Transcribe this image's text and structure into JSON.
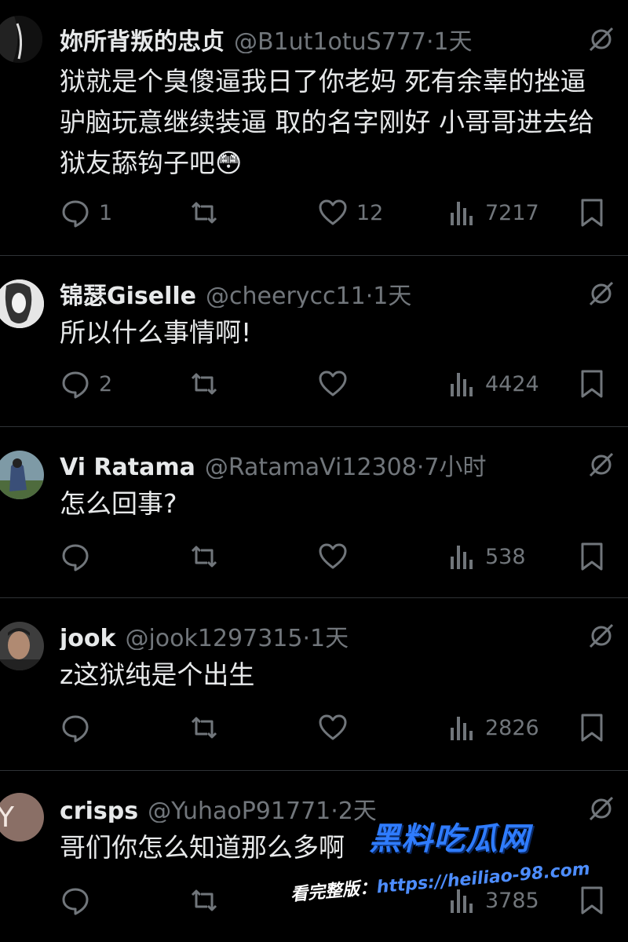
{
  "colors": {
    "background": "#000000",
    "text": "#e7e9ea",
    "secondary": "#71767b",
    "divider": "#2f3336",
    "watermark": "#2f7cff"
  },
  "posts": [
    {
      "name": "妳所背叛的忠贞",
      "handle": "@B1ut1otuS777",
      "time": "1天",
      "lines": [
        "狱就是个臭傻逼我日了你老妈 死有余辜的挫逼",
        "驴脑玩意继续装逼 取的名字刚好 小哥哥进去给",
        "狱友舔钩子吧😳"
      ],
      "replies": "1",
      "retweets": "",
      "likes": "12",
      "views": "7217",
      "avatar_color": "#1a1a1a"
    },
    {
      "name": "锦瑟Giselle",
      "handle": "@cheerycc11",
      "time": "1天",
      "lines": [
        "所以什么事情啊!"
      ],
      "replies": "2",
      "retweets": "",
      "likes": "",
      "views": "4424",
      "avatar_color": "#d8d8d8"
    },
    {
      "name": "Vi Ratama",
      "handle": "@RatamaVi12308",
      "time": "7小时",
      "lines": [
        "怎么回事?"
      ],
      "replies": "",
      "retweets": "",
      "likes": "",
      "views": "538",
      "avatar_color": "#5b7fa8"
    },
    {
      "name": "jook",
      "handle": "@jook1297315",
      "time": "1天",
      "lines": [
        "z这狱纯是个出生"
      ],
      "replies": "",
      "retweets": "",
      "likes": "",
      "views": "2826",
      "avatar_color": "#4a4a4a"
    },
    {
      "name": "crisps",
      "handle": "@YuhaoP91771",
      "time": "2天",
      "lines": [
        "哥们你怎么知道那么多啊"
      ],
      "replies": "",
      "retweets": "",
      "likes": "",
      "views": "3785",
      "avatar_color": "#8a6f66",
      "avatar_letter": "Y"
    }
  ],
  "watermark": {
    "title": "黑料吃瓜网",
    "prefix": "看完整版：",
    "url": "https://heiliao-98.com"
  }
}
